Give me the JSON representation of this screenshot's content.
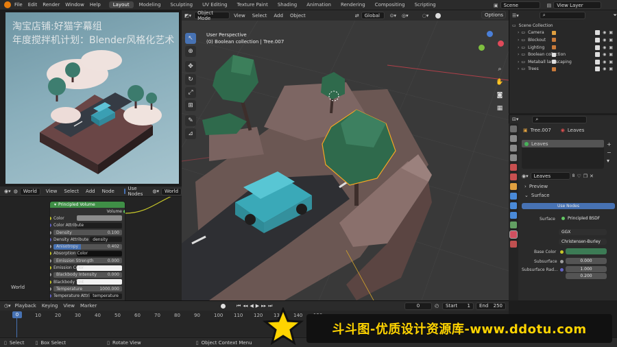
{
  "app": {
    "menu": [
      "File",
      "Edit",
      "Render",
      "Window",
      "Help"
    ],
    "workspaces": [
      "Layout",
      "Modeling",
      "Sculpting",
      "UV Editing",
      "Texture Paint",
      "Shading",
      "Animation",
      "Rendering",
      "Compositing",
      "Scripting"
    ],
    "active_workspace": "Layout",
    "scene": "Scene",
    "view_layer": "View Layer"
  },
  "overlay_text": {
    "line1": "淘宝店铺:好猫字幕组",
    "line2": "年度搅拌机计划：Blender风格化艺术"
  },
  "shader_editor": {
    "header": [
      "View",
      "Select",
      "Add",
      "Node"
    ],
    "world_selector": "World",
    "use_nodes_label": "Use Nodes",
    "world_field": "World",
    "corner_label": "World",
    "node": {
      "title": "Principled Volume",
      "output": "Volume",
      "rows": [
        {
          "label": "Color",
          "value": "",
          "kind": "color",
          "sock": "#c7c729"
        },
        {
          "label": "Color Attribute",
          "value": "",
          "kind": "field",
          "sock": "#6363c7"
        },
        {
          "label": "Density",
          "value": "0.100",
          "kind": "num",
          "sock": "#a1a1a1"
        },
        {
          "label": "Density Attribute",
          "value": "density",
          "kind": "text",
          "sock": "#6363c7"
        },
        {
          "label": "Anisotropy",
          "value": "0.402",
          "kind": "slider",
          "sock": "#a1a1a1"
        },
        {
          "label": "Absorption Color",
          "value": "",
          "kind": "dark",
          "sock": "#c7c729"
        },
        {
          "label": "Emission Strength",
          "value": "0.000",
          "kind": "num",
          "sock": "#a1a1a1"
        },
        {
          "label": "Emission Color",
          "value": "",
          "kind": "white",
          "sock": "#c7c729"
        },
        {
          "label": "Blackbody Intensity",
          "value": "0.000",
          "kind": "num",
          "sock": "#a1a1a1"
        },
        {
          "label": "Blackbody Tint",
          "value": "",
          "kind": "white",
          "sock": "#c7c729"
        },
        {
          "label": "Temperature",
          "value": "1000.000",
          "kind": "num",
          "sock": "#a1a1a1"
        },
        {
          "label": "Temperature Attri...",
          "value": "temperature",
          "kind": "text",
          "sock": "#6363c7"
        }
      ]
    }
  },
  "viewport": {
    "mode": "Object Mode",
    "menus": [
      "View",
      "Select",
      "Add",
      "Object"
    ],
    "transform_orientation": "Global",
    "options": "Options",
    "perspective_label": "User Perspective",
    "collection_label": "(0) Boolean collection | Tree.007"
  },
  "outliner": {
    "root": "Scene Collection",
    "items": [
      "Camera",
      "Blockout",
      "Lighting",
      "Boolean collection",
      "Metaball landscaping",
      "Trees"
    ]
  },
  "properties": {
    "object_name": "Tree.007",
    "material_name": "Leaves",
    "slot": "Leaves",
    "material_field": "Leaves",
    "user_count": "8",
    "sections": {
      "preview": "Preview",
      "surface": "Surface"
    },
    "use_nodes": "Use Nodes",
    "surface_label": "Surface",
    "surface_value": "Principled BSDF",
    "distribution": "GGX",
    "subsurface_method": "Christensen-Burley",
    "base_color_label": "Base Color",
    "base_color": "#3c7b55",
    "subsurface_label": "Subsurface",
    "subsurface_value": "0.000",
    "subsurface_radius_label": "Subsurface Rad...",
    "subsurface_radius_values": [
      "1.000",
      "0.200"
    ]
  },
  "timeline": {
    "menus": [
      "Playback",
      "Keying",
      "View",
      "Marker"
    ],
    "current_frame": "0",
    "start_label": "Start",
    "start": "1",
    "end_label": "End",
    "end": "250",
    "playhead": "0",
    "ticks": [
      "0",
      "10",
      "20",
      "30",
      "40",
      "50",
      "60",
      "70",
      "80",
      "90",
      "100",
      "110",
      "120",
      "130",
      "140",
      "150"
    ]
  },
  "statusbar": {
    "items": [
      "Select",
      "Box Select",
      "Rotate View",
      "Object Context Menu"
    ]
  },
  "watermark": {
    "text": "斗斗图-优质设计资源库-www.ddotu.com"
  },
  "colors": {
    "accent_blue": "#4772b3",
    "node_header_green": "#3f8f46",
    "selection_orange": "#f5a623",
    "watermark_yellow": "#ffd400"
  }
}
